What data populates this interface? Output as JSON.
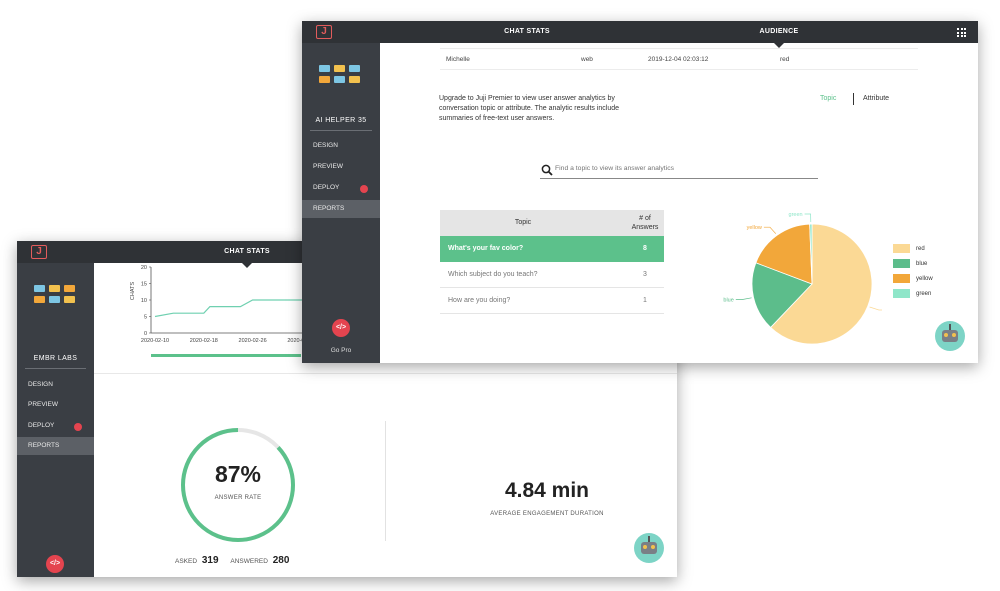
{
  "back_window": {
    "tab_chat_stats": "CHAT STATS",
    "bot_name": "EMBR LABS",
    "nav": [
      {
        "label": "DESIGN",
        "active": false
      },
      {
        "label": "PREVIEW",
        "active": false
      },
      {
        "label": "DEPLOY",
        "active": false
      },
      {
        "label": "REPORTS",
        "active": true
      }
    ],
    "code_icon": "</>",
    "answer_rate": {
      "value_text": "87%",
      "label": "ANSWER RATE",
      "fraction": 0.87
    },
    "asked_label": "ASKED",
    "asked_value": "319",
    "answered_label": "ANSWERED",
    "answered_value": "280",
    "duration_value": "4.84 min",
    "duration_label": "AVERAGE ENGAGEMENT DURATION"
  },
  "line_chart": {
    "ylabel": "CHATS",
    "yticks": [
      "20",
      "15",
      "10",
      "5",
      "0"
    ],
    "xticks": [
      "2020-02-10",
      "2020-02-18",
      "2020-02-26",
      "2020-03-05"
    ]
  },
  "front_window": {
    "tab_chat_stats": "CHAT STATS",
    "tab_audience": "AUDIENCE",
    "bot_name": "AI HELPER 35",
    "nav": [
      {
        "label": "DESIGN",
        "active": false
      },
      {
        "label": "PREVIEW",
        "active": false
      },
      {
        "label": "DEPLOY",
        "active": false
      },
      {
        "label": "REPORTS",
        "active": true
      }
    ],
    "code_icon": "</>",
    "go_pro": "Go Pro",
    "audience_row": {
      "name": "Michelle",
      "channel": "web",
      "time": "2019-12-04 02:03:12",
      "value": "red"
    },
    "upgrade_text": "Upgrade to Juji Premier to view user answer analytics by conversation topic or attribute. The analytic results include summaries of free-text user answers.",
    "toggle_topic": "Topic",
    "toggle_attribute": "Attribute",
    "search_placeholder": "Find a topic to view its answer analytics",
    "table": {
      "col_topic": "Topic",
      "col_answers": "# of Answers",
      "rows": [
        {
          "topic": "What's your fav color?",
          "answers": "8",
          "selected": true
        },
        {
          "topic": "Which subject do you teach?",
          "answers": "3",
          "selected": false
        },
        {
          "topic": "How are you doing?",
          "answers": "1",
          "selected": false
        }
      ]
    }
  },
  "colors": {
    "accent_green": "#5cc18b",
    "red": "#fbd995",
    "blue": "#5cbd8b",
    "yellow": "#f2a73a",
    "green": "#8fe6c9",
    "sidebar": "#3a3e44",
    "topbar": "#2f3236",
    "alert_red": "#e4444f"
  },
  "chart_data": [
    {
      "type": "line",
      "ylabel": "CHATS",
      "x": [
        "2020-02-10",
        "2020-02-13",
        "2020-02-18",
        "2020-02-19",
        "2020-02-24",
        "2020-02-26",
        "2020-03-05"
      ],
      "series": [
        {
          "values": [
            5,
            6,
            6,
            8,
            8,
            10,
            10
          ]
        }
      ],
      "ylim": [
        0,
        20
      ],
      "grid": false
    },
    {
      "type": "pie",
      "categories": [
        "red",
        "blue",
        "yellow",
        "green"
      ],
      "values": [
        5,
        1.5,
        1.5,
        0.05
      ],
      "legend": "right"
    }
  ]
}
